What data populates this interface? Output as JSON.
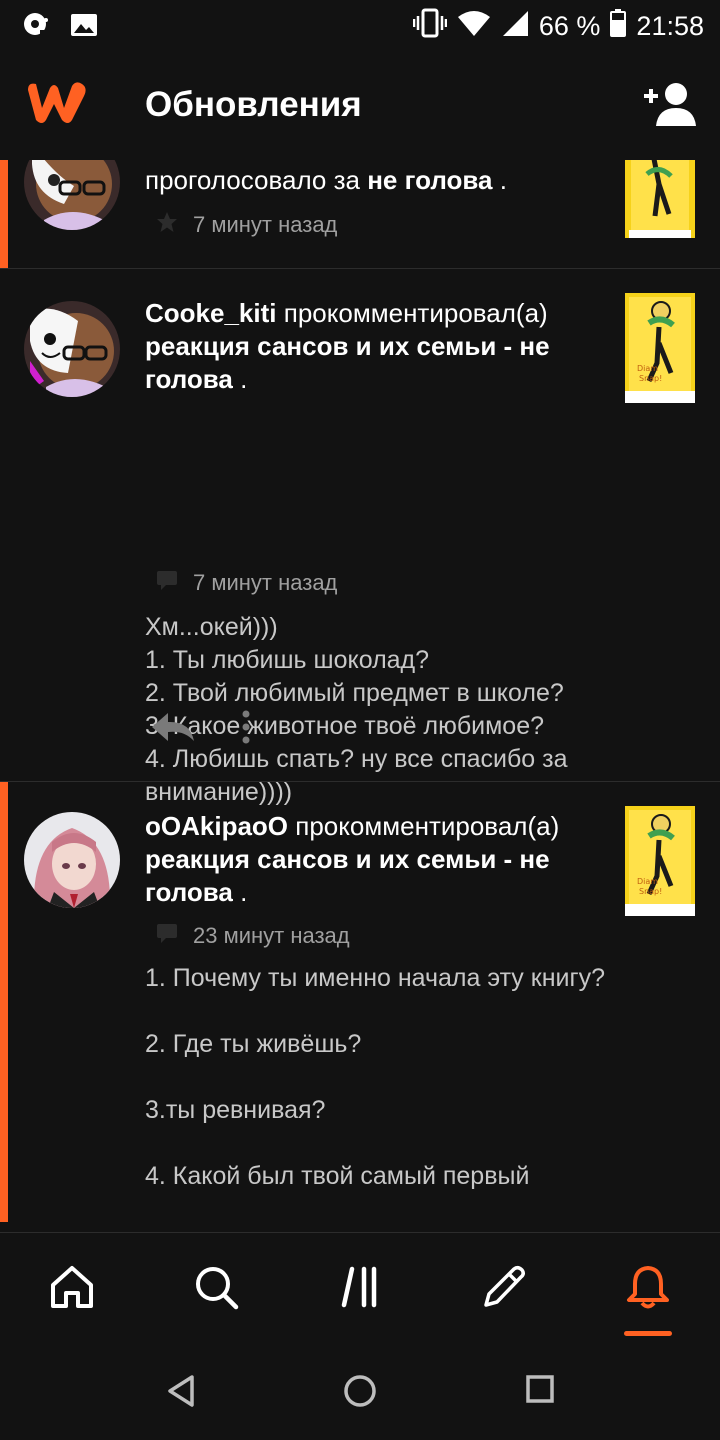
{
  "status_bar": {
    "battery": "66 %",
    "time": "21:58"
  },
  "header": {
    "title": "Обновления",
    "logo_icon": "wattpad-w-logo",
    "add_friend_icon": "add-user-icon"
  },
  "feed": [
    {
      "tail": "проголосовало за",
      "story": "не голова",
      "suffix": ".",
      "time": "7 минут назад",
      "meta_icon": "star-icon"
    },
    {
      "user": "Cooke_kiti",
      "action": "прокомментировал(а)",
      "story": "реакция сансов и их семьи - не голова",
      "suffix": ".",
      "time": "7 минут назад",
      "meta_icon": "comment-icon",
      "comment": "Хм...окей)))\n1. Ты любишь шоколад?\n2. Твой любимый предмет в школе?\n3. Какое животное твоё любимое?\n4. Любишь спать? ну все спасибо за внимание))))"
    },
    {
      "user": "oOAkipaoO",
      "action": "прокомментировал(а)",
      "story": "реакция сансов и их семьи - не голова",
      "suffix": ".",
      "time": "23 минут назад",
      "meta_icon": "comment-icon",
      "comment": "1. Почему ты именно начала эту книгу?\n\n2. Где ты живёшь?\n\n3.ты ревнивая?\n\n4. Какой был твой самый первый"
    }
  ],
  "tabs": [
    {
      "name": "home",
      "icon": "home-icon"
    },
    {
      "name": "search",
      "icon": "search-icon"
    },
    {
      "name": "library",
      "icon": "library-icon"
    },
    {
      "name": "write",
      "icon": "pencil-icon"
    },
    {
      "name": "notifications",
      "icon": "bell-icon",
      "active": true
    }
  ],
  "colors": {
    "accent": "#ff6122",
    "background": "#121212",
    "divider": "#2c2c2c"
  }
}
